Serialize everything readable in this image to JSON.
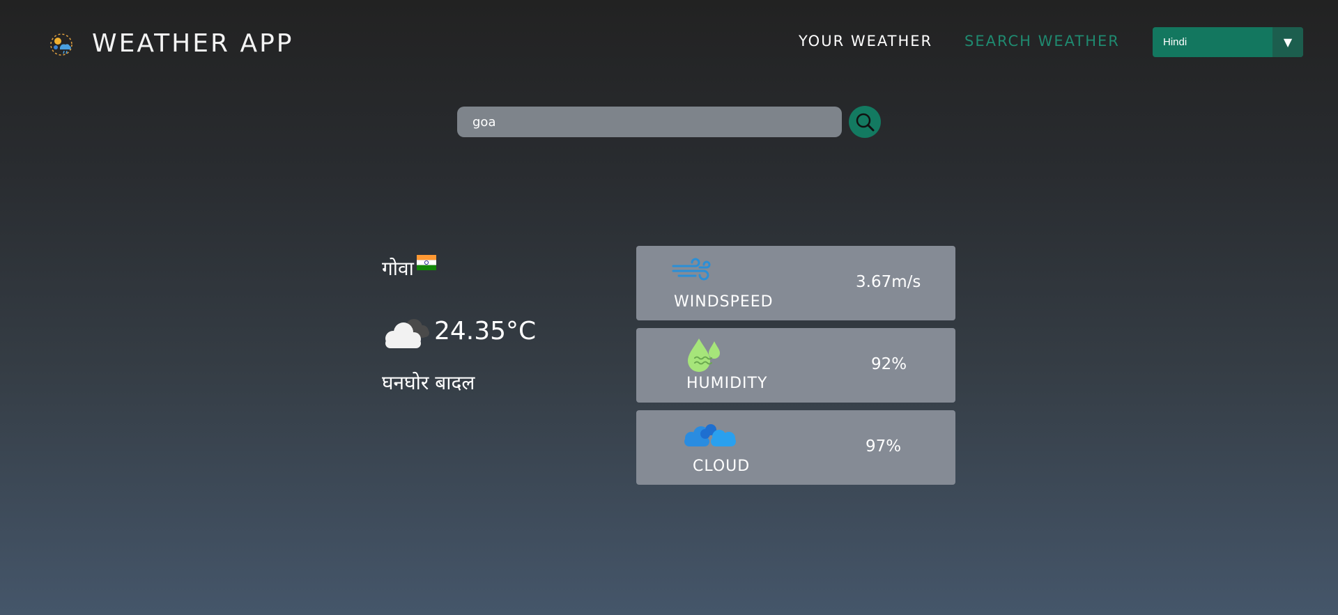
{
  "header": {
    "app_title": "WEATHER APP",
    "logo_icon": "weather-logo-icon",
    "nav": {
      "your_weather": "YOUR WEATHER",
      "search_weather": "SEARCH WEATHER"
    },
    "language": {
      "selected": "Hindi",
      "arrow": "▼"
    }
  },
  "search": {
    "value": "goa",
    "button_icon": "search-icon"
  },
  "current": {
    "city": "गोवा",
    "flag_icon": "india-flag-icon",
    "condition_icon": "cloud-icon",
    "temperature": "24.35°C",
    "condition": "घनघोर बादल"
  },
  "stats": {
    "wind": {
      "label": "WINDSPEED",
      "value": "3.67m/s",
      "icon": "wind-icon"
    },
    "humidity": {
      "label": "HUMIDITY",
      "value": "92%",
      "icon": "humidity-icon"
    },
    "cloud": {
      "label": "CLOUD",
      "value": "97%",
      "icon": "clouds-icon"
    }
  },
  "colors": {
    "accent": "#137a61",
    "nav_inactive": "#1f8a70",
    "card_bg": "#858b95",
    "input_bg": "#7e848b"
  }
}
